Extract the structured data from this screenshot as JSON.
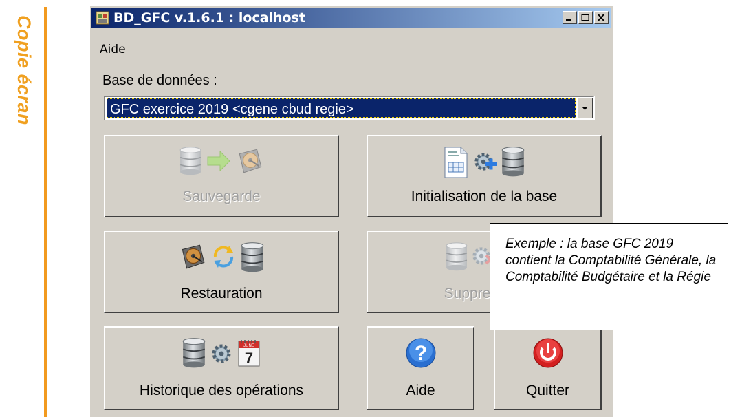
{
  "side_label": "Copie écran",
  "window": {
    "title": "BD_GFC v.1.6.1 : localhost",
    "controls": [
      "minimize",
      "maximize",
      "close"
    ]
  },
  "menu": {
    "items": [
      "Aide"
    ]
  },
  "database": {
    "label": "Base de données :",
    "selected": "GFC exercice 2019 <cgene cbud regie>"
  },
  "buttons": {
    "sauvegarde": "Sauvegarde",
    "initialisation": "Initialisation de la base",
    "restauration": "Restauration",
    "suppression": "Suppression",
    "historique": "Historique des opérations",
    "aide": "Aide",
    "quitter": "Quitter"
  },
  "callout": {
    "text": "Exemple : la base GFC 2019 contient la Comptabilité Générale, la Comptabilité Budgétaire et la Régie"
  },
  "calendar_icon": {
    "month": "JUNE",
    "day": "7"
  },
  "colors": {
    "accent": "#f29a1f",
    "title_bar": "#0a246a",
    "window_bg": "#d4d0c8"
  }
}
